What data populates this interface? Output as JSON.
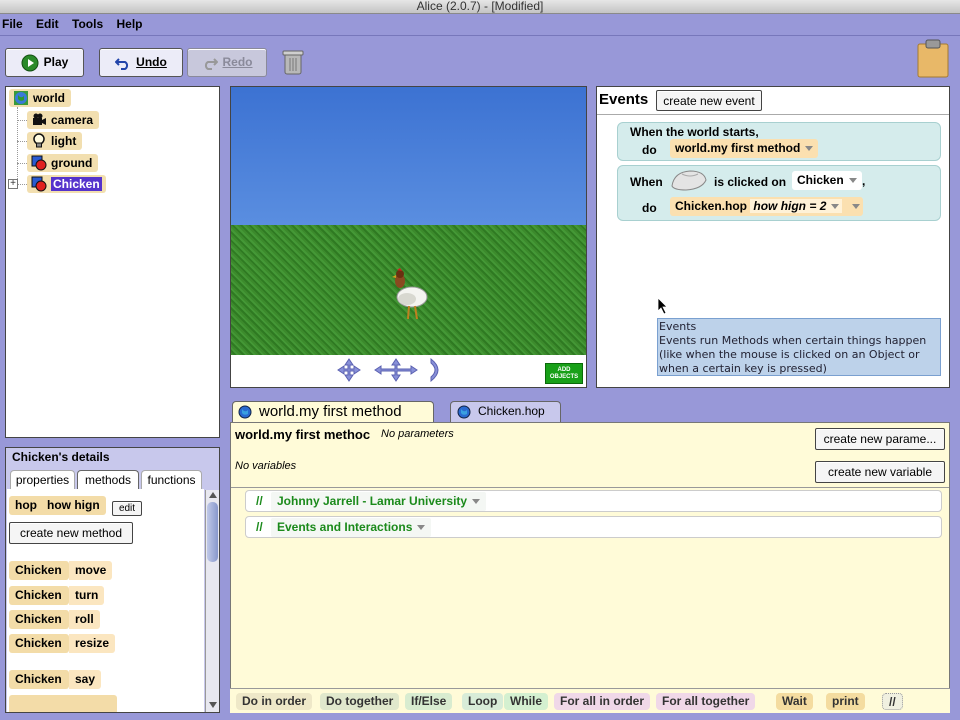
{
  "window": {
    "title": "Alice (2.0.7) -  [Modified]"
  },
  "menu": {
    "file": "File",
    "edit": "Edit",
    "tools": "Tools",
    "help": "Help"
  },
  "toolbar": {
    "play": "Play",
    "undo": "Undo",
    "redo": "Redo"
  },
  "tree": {
    "world": "world",
    "camera": "camera",
    "light": "light",
    "ground": "ground",
    "chicken": "Chicken",
    "expander": "+"
  },
  "scene": {
    "add_objects": "ADD\nOBJECTS"
  },
  "events": {
    "title": "Events",
    "create_button": "create new event",
    "event1": {
      "when": "When the world starts,",
      "do": "do",
      "method": "world.my first method"
    },
    "event2": {
      "when": "When",
      "clicked": "is clicked on",
      "object": "Chicken",
      "comma": ",",
      "do": "do",
      "method": "Chicken.hop",
      "param": "how hign = 2"
    },
    "tooltip": {
      "line1": "Events",
      "line2": "Events run Methods when certain things happen",
      "line3": "(like when the mouse is clicked on an Object or",
      "line4": "when a certain key is pressed)"
    }
  },
  "details": {
    "title": "Chicken's details",
    "tabs": [
      "properties",
      "methods",
      "functions"
    ],
    "hop_method": {
      "name": "hop",
      "param": "how hign",
      "edit": "edit"
    },
    "create_method": "create new method",
    "methods": [
      {
        "object": "Chicken",
        "action": "move"
      },
      {
        "object": "Chicken",
        "action": "turn"
      },
      {
        "object": "Chicken",
        "action": "roll"
      },
      {
        "object": "Chicken",
        "action": "resize"
      },
      {
        "object": "Chicken",
        "action": "say"
      }
    ]
  },
  "editor": {
    "tabs": [
      "world.my first method",
      "Chicken.hop"
    ],
    "method_name": "world.my first methoc",
    "no_params": "No parameters",
    "no_vars": "No variables",
    "create_param": "create new parame...",
    "create_var": "create new variable",
    "comments": [
      {
        "slash": "//",
        "text": "Johnny Jarrell - Lamar University"
      },
      {
        "slash": "//",
        "text": "Events and Interactions"
      }
    ]
  },
  "controls": [
    "Do in order",
    "Do together",
    "If/Else",
    "Loop",
    "While",
    "For all in order",
    "For all together",
    "Wait",
    "print",
    "//"
  ],
  "colors": {
    "background": "#9898d8",
    "tile": "#f3dca8",
    "event_box": "#d5ecec",
    "editor": "#fffbd8",
    "comment_green": "#1b8a1b",
    "selected": "#5533cc"
  }
}
